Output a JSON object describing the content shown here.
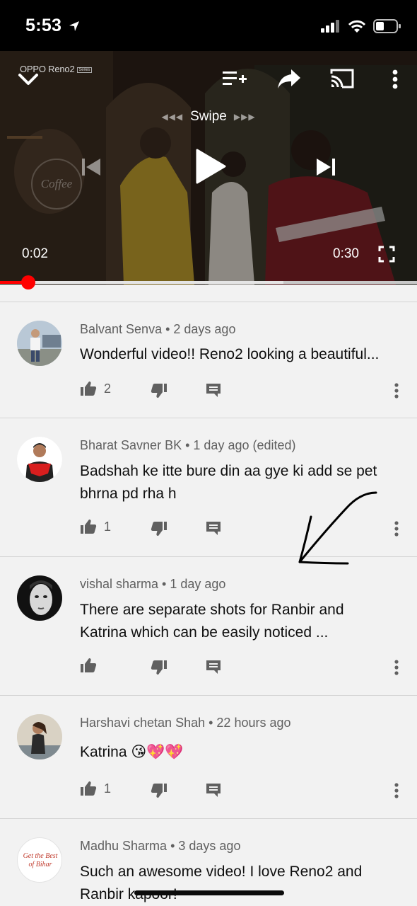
{
  "status_bar": {
    "time": "5:53"
  },
  "player": {
    "overlay_brand": "OPPO Reno2",
    "overlay_brand_tag": "Series",
    "scene_sign_text": "Coffee",
    "swipe_label": "Swipe",
    "current_time": "0:02",
    "duration": "0:30",
    "progress_fraction": 0.067,
    "accent_color": "#ff0000"
  },
  "comments": [
    {
      "author": "Balvant Senva",
      "age": "2 days ago",
      "text": "Wonderful video!! Reno2 looking a beautiful...",
      "likes": "2"
    },
    {
      "author": "Bharat Savner BK",
      "age": "1 day ago (edited)",
      "text": "Badshah ke itte bure din aa gye ki add se pet bhrna pd rha h",
      "likes": "1"
    },
    {
      "author": "vishal sharma",
      "age": "1 day ago",
      "text": "There are separate shots for Ranbir and Katrina which can be easily noticed ...",
      "likes": ""
    },
    {
      "author": "Harshavi chetan Shah",
      "age": "22 hours ago",
      "text": "Katrina 😘💖💖",
      "likes": "1"
    },
    {
      "author": "Madhu Sharma",
      "age": "3 days ago",
      "text": "Such an awesome video! I love Reno2 and Ranbir kapoor!",
      "likes": "",
      "avatar_text": "Get the Best of Bihar"
    }
  ],
  "icons": {
    "player": [
      "chevron-down-icon",
      "add-to-queue-icon",
      "share-icon",
      "cast-icon",
      "more-vert-icon",
      "previous-icon",
      "play-icon",
      "next-icon",
      "fullscreen-icon"
    ],
    "comment": [
      "thumb-up-icon",
      "thumb-down-icon",
      "reply-icon",
      "more-vert-icon"
    ]
  }
}
